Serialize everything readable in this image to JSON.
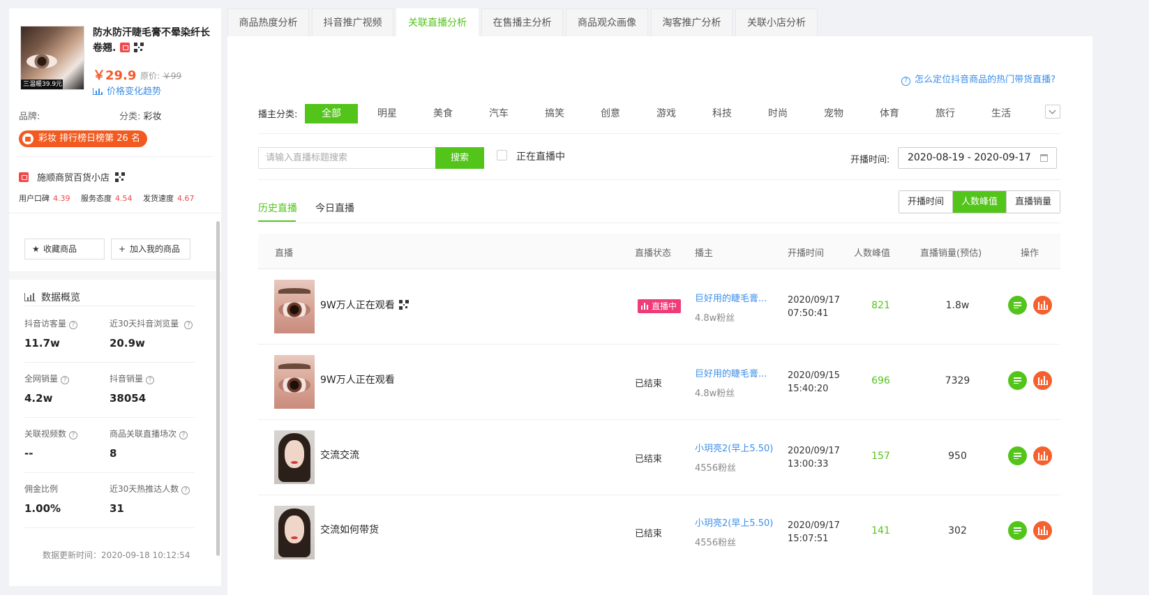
{
  "product": {
    "title": "防水防汗睫毛膏不晕染纤长卷翘.",
    "thumb_price_text": "三温暖39.9元",
    "price": "￥29.9",
    "original_price_label": "原价:",
    "original_price": "￥99",
    "price_trend_link": "价格变化趋势",
    "brand_label": "品牌:",
    "brand_value": "",
    "category_label": "分类:",
    "category_value": "彩妆",
    "rank_badge": "彩妆 排行榜日榜第 26 名"
  },
  "shop": {
    "name": "施顺商贸百货小店",
    "scores": [
      {
        "label": "用户口碑",
        "value": "4.39"
      },
      {
        "label": "服务态度",
        "value": "4.54"
      },
      {
        "label": "发货速度",
        "value": "4.67"
      }
    ]
  },
  "actions": {
    "favorite": "收藏商品",
    "add_mine": "加入我的商品"
  },
  "overview": {
    "title": "数据概览",
    "stats": [
      {
        "label": "抖音访客量",
        "value": "11.7w"
      },
      {
        "label": "近30天抖音浏览量",
        "value": "20.9w"
      },
      {
        "label": "全网销量",
        "value": "4.2w"
      },
      {
        "label": "抖音销量",
        "value": "38054"
      },
      {
        "label": "关联视频数",
        "value": "--"
      },
      {
        "label": "商品关联直播场次",
        "value": "8"
      },
      {
        "label": "佣金比例",
        "value": "1.00%"
      },
      {
        "label": "近30天热推达人数",
        "value": "31"
      }
    ],
    "updated": "数据更新时间：2020-09-18 10:12:54"
  },
  "tabs": [
    "商品热度分析",
    "抖音推广视频",
    "关联直播分析",
    "在售播主分析",
    "商品观众画像",
    "淘客推广分析",
    "关联小店分析"
  ],
  "help_link": "怎么定位抖音商品的热门带货直播?",
  "category_filter": {
    "label": "播主分类:",
    "items": [
      "全部",
      "明星",
      "美食",
      "汽车",
      "搞笑",
      "创意",
      "游戏",
      "科技",
      "时尚",
      "宠物",
      "体育",
      "旅行",
      "生活"
    ]
  },
  "search": {
    "placeholder": "请输入直播标题搜索",
    "button": "搜索",
    "live_only_label": "正在直播中",
    "date_label": "开播时间:",
    "date_range": "2020-08-19 - 2020-09-17"
  },
  "subtabs": [
    "历史直播",
    "今日直播"
  ],
  "sort_buttons": [
    "开播时间",
    "人数峰值",
    "直播销量"
  ],
  "table": {
    "headers": [
      "直播",
      "直播状态",
      "播主",
      "开播时间",
      "人数峰值",
      "直播销量(预估)",
      "操作"
    ],
    "rows": [
      {
        "title": "9W万人正在观看",
        "status": "直播中",
        "anchor": "巨好用的睫毛膏...",
        "fans": "4.8w粉丝",
        "date": "2020/09/17",
        "time": "07:50:41",
        "peak": "821",
        "sales": "1.8w"
      },
      {
        "title": "9W万人正在观看",
        "status": "已结束",
        "anchor": "巨好用的睫毛膏...",
        "fans": "4.8w粉丝",
        "date": "2020/09/15",
        "time": "15:40:20",
        "peak": "696",
        "sales": "7329"
      },
      {
        "title": "交流交流",
        "status": "已结束",
        "anchor": "小玥亮2(早上5.50)",
        "fans": "4556粉丝",
        "date": "2020/09/17",
        "time": "13:00:33",
        "peak": "157",
        "sales": "950"
      },
      {
        "title": "交流如何带货",
        "status": "已结束",
        "anchor": "小玥亮2(早上5.50)",
        "fans": "4556粉丝",
        "date": "2020/09/17",
        "time": "15:07:51",
        "peak": "141",
        "sales": "302"
      }
    ]
  },
  "colors": {
    "accent": "#52c41a",
    "link": "#3b8ee8",
    "price": "#f25a2a",
    "live": "#ef3b78",
    "chart_btn": "#f4612e"
  }
}
